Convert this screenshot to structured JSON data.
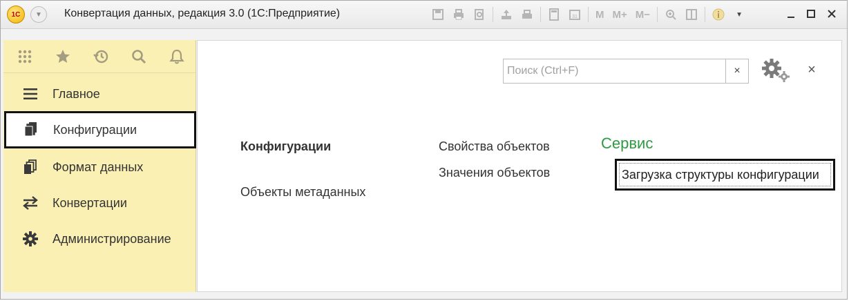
{
  "window": {
    "title": "Конвертация данных, редакция 3.0  (1С:Предприятие)",
    "logo_text": "1С",
    "toolbar": {
      "m_label": "M",
      "mplus_label": "M+",
      "mminus_label": "M−",
      "calendar_day": "31"
    }
  },
  "sidebar": {
    "top_icons": [
      "apps-grid-icon",
      "star-icon",
      "history-icon",
      "search-icon",
      "bell-icon"
    ],
    "sections": [
      {
        "label": "Главное",
        "icon": "menu-lines-icon",
        "active": false
      },
      {
        "label": "Конфигурации",
        "icon": "documents-icon",
        "active": true
      },
      {
        "label": "Формат данных",
        "icon": "documents-icon",
        "active": false
      },
      {
        "label": "Конвертации",
        "icon": "arrows-exchange-icon",
        "active": false
      },
      {
        "label": "Администрирование",
        "icon": "gear-icon",
        "active": false
      }
    ]
  },
  "search": {
    "placeholder": "Поиск (Ctrl+F)",
    "value": "",
    "clear": "×"
  },
  "panel_close": "×",
  "main": {
    "group1_header": "Конфигурации",
    "group1_items": [
      "Объекты метаданных"
    ],
    "group2_items": [
      "Свойства объектов",
      "Значения объектов"
    ],
    "service_header": "Сервис",
    "service_items": [
      "Загрузка структуры конфигурации"
    ]
  },
  "colors": {
    "sidebar_bg": "#faf0b4",
    "service_header": "#2e9b43",
    "highlight_border": "#111111"
  }
}
